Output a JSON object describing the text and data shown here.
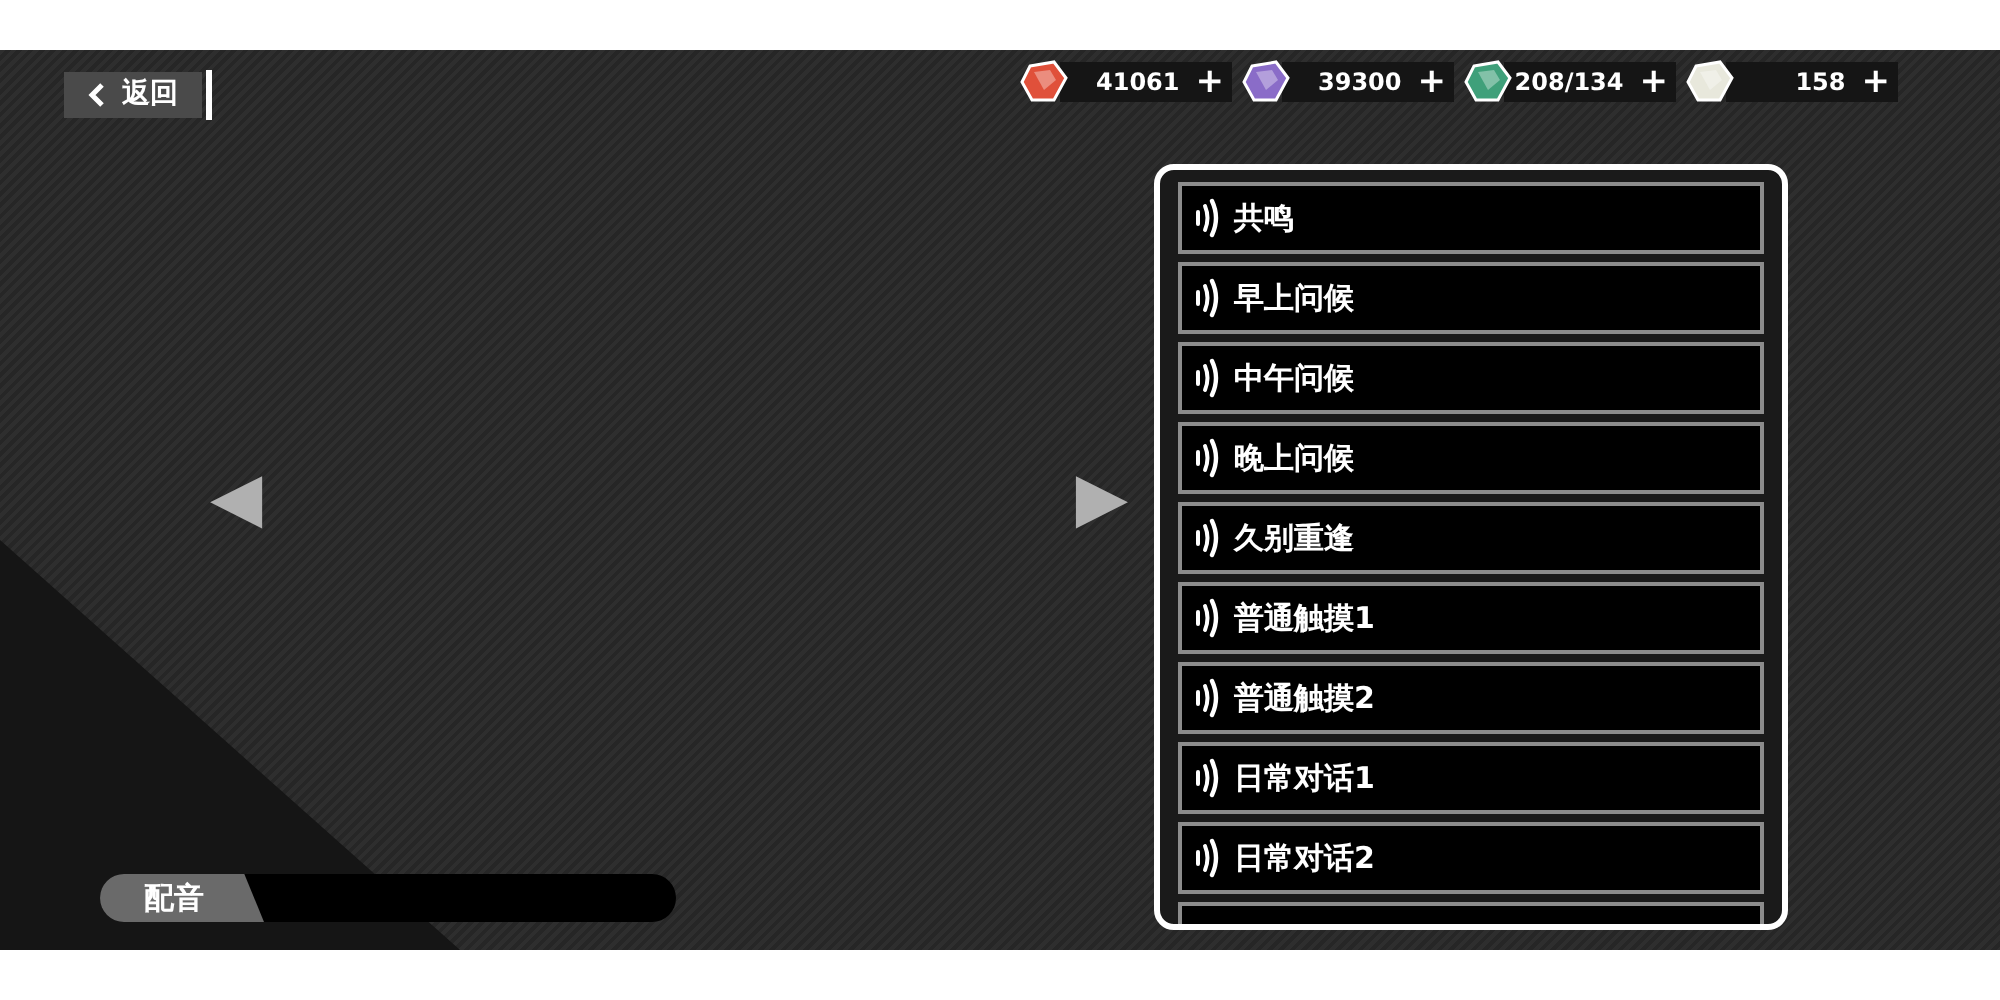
{
  "back_button": {
    "label": "返回"
  },
  "currencies": [
    {
      "color": "#e0503a",
      "amount": "41061",
      "plus": "+"
    },
    {
      "color": "#8a6cc8",
      "amount": "39300",
      "plus": "+"
    },
    {
      "color": "#3fa07a",
      "amount": "208/134",
      "plus": "+"
    },
    {
      "color": "#e8e8dc",
      "amount": "158",
      "plus": "+"
    }
  ],
  "nav": {
    "previous": "◀",
    "next": "▶"
  },
  "voice_lines": [
    {
      "label": "共鸣"
    },
    {
      "label": "早上问候"
    },
    {
      "label": "中午问候"
    },
    {
      "label": "晚上问候"
    },
    {
      "label": "久别重逢"
    },
    {
      "label": "普通触摸1"
    },
    {
      "label": "普通触摸2"
    },
    {
      "label": "日常对话1"
    },
    {
      "label": "日常对话2"
    }
  ],
  "caption": {
    "label": "配音"
  }
}
